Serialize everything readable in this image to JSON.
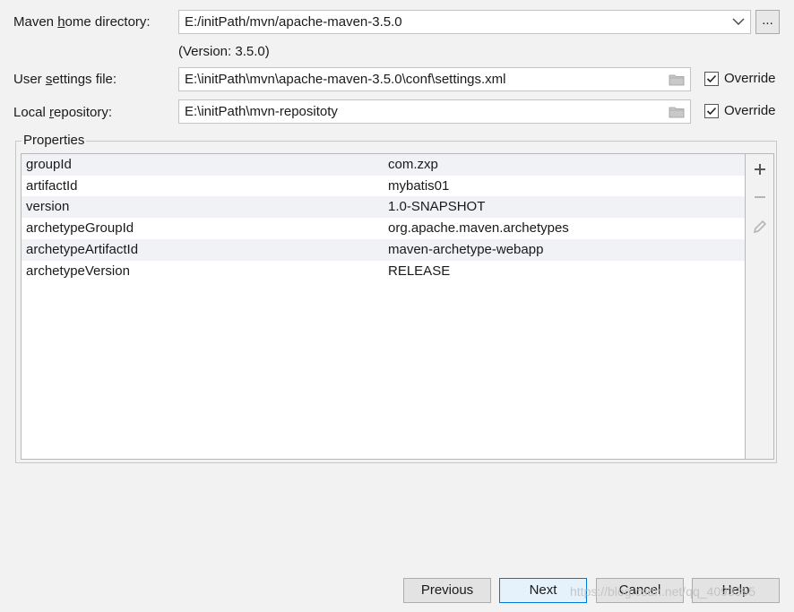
{
  "maven_home": {
    "label_pre": "Maven ",
    "label_mnemonic": "h",
    "label_post": "ome directory:",
    "value": "E:/initPath/mvn/apache-maven-3.5.0",
    "browse_label": "...",
    "version_text": "(Version: 3.5.0)"
  },
  "user_settings": {
    "label_pre": "User ",
    "label_mnemonic": "s",
    "label_post": "ettings file:",
    "value": "E:\\initPath\\mvn\\apache-maven-3.5.0\\conf\\settings.xml",
    "override_label": "Override",
    "override_checked": true
  },
  "local_repo": {
    "label_pre": "Local ",
    "label_mnemonic": "r",
    "label_post": "epository:",
    "value": "E:\\initPath\\mvn-repositoty",
    "override_label": "Override",
    "override_checked": true
  },
  "properties": {
    "title": "Properties",
    "rows": [
      {
        "key": "groupId",
        "value": "com.zxp"
      },
      {
        "key": "artifactId",
        "value": "mybatis01"
      },
      {
        "key": "version",
        "value": "1.0-SNAPSHOT"
      },
      {
        "key": "archetypeGroupId",
        "value": "org.apache.maven.archetypes"
      },
      {
        "key": "archetypeArtifactId",
        "value": "maven-archetype-webapp"
      },
      {
        "key": "archetypeVersion",
        "value": "RELEASE"
      }
    ],
    "side_icons": [
      "add-icon",
      "remove-icon",
      "edit-icon"
    ]
  },
  "buttons": {
    "previous": "Previous",
    "next": "Next",
    "cancel": "Cancel",
    "help": "Help"
  },
  "watermark": "https://blog.csdn.net/qq_4093395",
  "colors": {
    "background": "#f2f2f2",
    "default_button_border": "#0078d7",
    "alt_row": "#f0f2f5"
  }
}
